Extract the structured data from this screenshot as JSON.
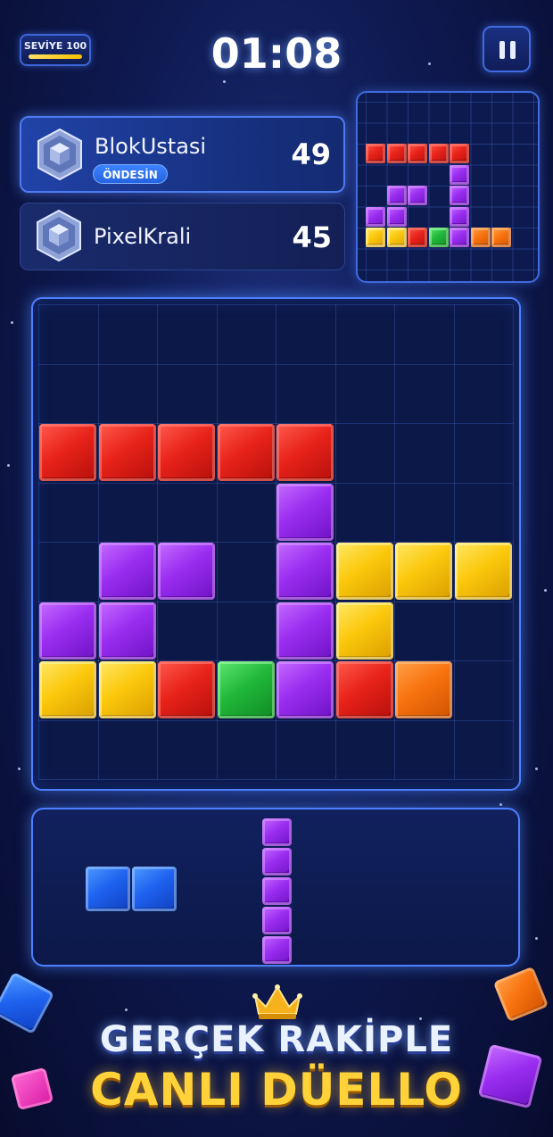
{
  "hud": {
    "level_label": "SEVİYE 100",
    "timer": "01:08",
    "pause_icon": "pause-icon"
  },
  "players": [
    {
      "name": "BlokUstasi",
      "score": "49",
      "badge": "ÖNDESİN",
      "avatar_icon": "hexagon-cube-icon"
    },
    {
      "name": "PixelKrali",
      "score": "45",
      "avatar_icon": "hexagon-cube-icon"
    }
  ],
  "board": {
    "cols": 8,
    "rows": 8,
    "cells": [
      {
        "r": 2,
        "c": 0,
        "color": "red"
      },
      {
        "r": 2,
        "c": 1,
        "color": "red"
      },
      {
        "r": 2,
        "c": 2,
        "color": "red"
      },
      {
        "r": 2,
        "c": 3,
        "color": "red"
      },
      {
        "r": 2,
        "c": 4,
        "color": "red"
      },
      {
        "r": 3,
        "c": 4,
        "color": "purple"
      },
      {
        "r": 4,
        "c": 1,
        "color": "purple"
      },
      {
        "r": 4,
        "c": 2,
        "color": "purple"
      },
      {
        "r": 4,
        "c": 4,
        "color": "purple"
      },
      {
        "r": 4,
        "c": 5,
        "color": "yellow"
      },
      {
        "r": 4,
        "c": 6,
        "color": "yellow"
      },
      {
        "r": 4,
        "c": 7,
        "color": "yellow"
      },
      {
        "r": 5,
        "c": 0,
        "color": "purple"
      },
      {
        "r": 5,
        "c": 1,
        "color": "purple"
      },
      {
        "r": 5,
        "c": 4,
        "color": "purple"
      },
      {
        "r": 5,
        "c": 5,
        "color": "yellow"
      },
      {
        "r": 6,
        "c": 0,
        "color": "yellow"
      },
      {
        "r": 6,
        "c": 1,
        "color": "yellow"
      },
      {
        "r": 6,
        "c": 2,
        "color": "red"
      },
      {
        "r": 6,
        "c": 3,
        "color": "green"
      },
      {
        "r": 6,
        "c": 4,
        "color": "purple"
      },
      {
        "r": 6,
        "c": 5,
        "color": "red"
      },
      {
        "r": 6,
        "c": 6,
        "color": "orange"
      }
    ]
  },
  "opponent_preview": {
    "cells": [
      {
        "r": 2,
        "c": 0,
        "color": "red"
      },
      {
        "r": 2,
        "c": 1,
        "color": "red"
      },
      {
        "r": 2,
        "c": 2,
        "color": "red"
      },
      {
        "r": 2,
        "c": 3,
        "color": "red"
      },
      {
        "r": 2,
        "c": 4,
        "color": "red"
      },
      {
        "r": 3,
        "c": 4,
        "color": "purple"
      },
      {
        "r": 4,
        "c": 1,
        "color": "purple"
      },
      {
        "r": 4,
        "c": 2,
        "color": "purple"
      },
      {
        "r": 4,
        "c": 4,
        "color": "purple"
      },
      {
        "r": 5,
        "c": 0,
        "color": "purple"
      },
      {
        "r": 5,
        "c": 1,
        "color": "purple"
      },
      {
        "r": 5,
        "c": 4,
        "color": "purple"
      },
      {
        "r": 6,
        "c": 0,
        "color": "yellow"
      },
      {
        "r": 6,
        "c": 1,
        "color": "yellow"
      },
      {
        "r": 6,
        "c": 2,
        "color": "red"
      },
      {
        "r": 6,
        "c": 3,
        "color": "green"
      },
      {
        "r": 6,
        "c": 4,
        "color": "purple"
      },
      {
        "r": 6,
        "c": 5,
        "color": "orange"
      },
      {
        "r": 6,
        "c": 6,
        "color": "orange"
      }
    ]
  },
  "tray": {
    "pieces": [
      {
        "name": "horizontal-2",
        "color": "blue",
        "orientation": "horizontal",
        "length": 2
      },
      {
        "name": "vertical-5",
        "color": "purple",
        "orientation": "vertical",
        "length": 5
      }
    ]
  },
  "promo": {
    "line1": "GERÇEK RAKİPLE",
    "line2": "CANLI DÜELLO",
    "crown_icon": "crown-icon"
  }
}
